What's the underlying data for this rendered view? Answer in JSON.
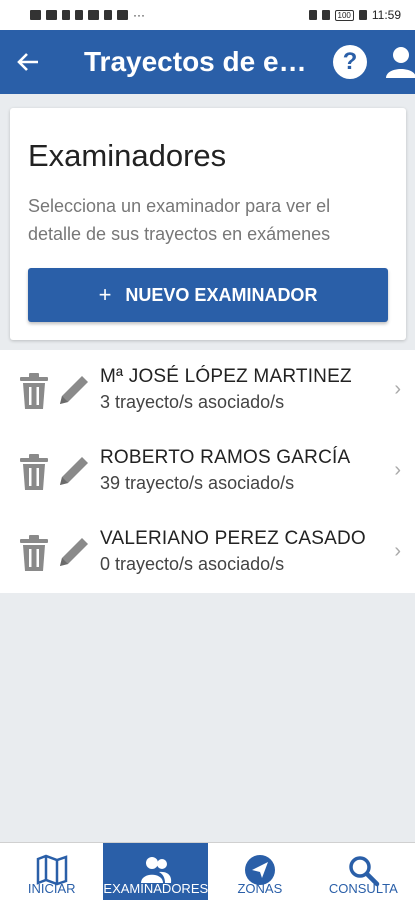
{
  "status_bar": {
    "time": "11:59",
    "battery": "100"
  },
  "header": {
    "title": "Trayectos de exámenes",
    "back_icon": "arrow-left-icon",
    "help_label": "?",
    "user_icon": "user-icon"
  },
  "intro_card": {
    "title": "Examinadores",
    "description": "Selecciona un examinador para ver el detalle de sus trayectos en exámenes",
    "button_label": "NUEVO EXAMINADOR",
    "button_icon": "+"
  },
  "examiners": [
    {
      "name": "Mª JOSÉ LÓPEZ MARTINEZ",
      "routes": "3 trayecto/s asociado/s"
    },
    {
      "name": "ROBERTO RAMOS GARCÍA",
      "routes": "39 trayecto/s asociado/s"
    },
    {
      "name": "VALERIANO PEREZ CASADO",
      "routes": "0 trayecto/s asociado/s"
    }
  ],
  "bottom_nav": [
    {
      "label": "INICIAR",
      "icon": "map-icon",
      "active": false
    },
    {
      "label": "EXAMINADORES",
      "icon": "users-icon",
      "active": true
    },
    {
      "label": "ZONAS",
      "icon": "navigation-icon",
      "active": false
    },
    {
      "label": "CONSULTA",
      "icon": "search-icon",
      "active": false
    }
  ],
  "colors": {
    "primary": "#2a5fa8",
    "background": "#e9ecef"
  }
}
